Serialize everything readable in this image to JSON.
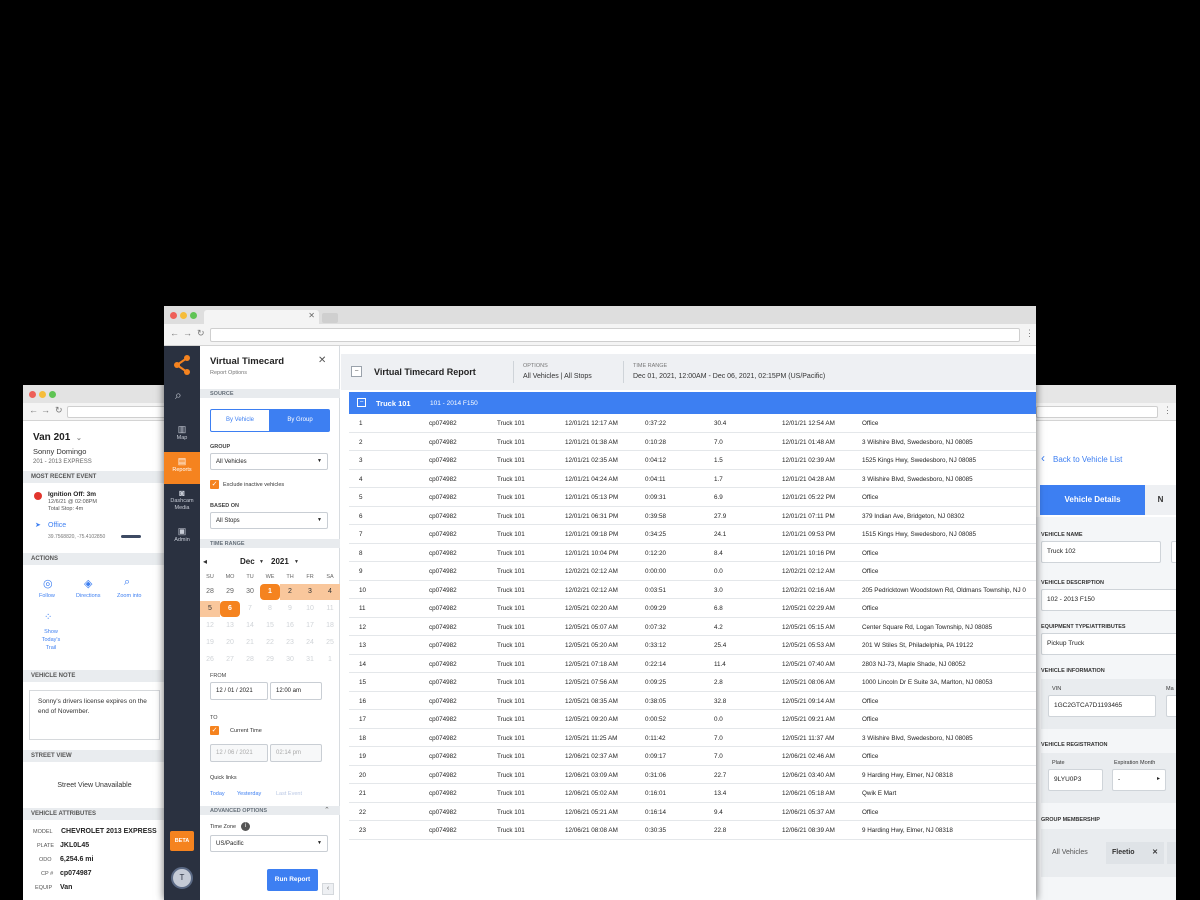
{
  "left_window": {
    "vehicle_name": "Van 201",
    "driver": "Sonny Domingo",
    "subtitle": "201 - 2013 EXPRESS",
    "most_recent_event_label": "MOST RECENT EVENT",
    "event_title": "Ignition Off: 3m",
    "event_time": "12/6/21 @ 02:08PM",
    "event_stop": "Total Stop: 4m",
    "location_name": "Office",
    "coordinates": "39.7568820, -75.4102850",
    "actions_label": "ACTIONS",
    "actions": [
      "Follow",
      "Directions",
      "Zoom into"
    ],
    "show_trail": "Show Today's Trail",
    "vehicle_note_label": "VEHICLE NOTE",
    "note_text": "Sonny's drivers license expires on the end of November.",
    "street_view_label": "STREET VIEW",
    "street_view_text": "Street View Unavailable",
    "attributes_label": "VEHICLE ATTRIBUTES",
    "attributes": [
      {
        "key": "MODEL",
        "value": "CHEVROLET 2013 EXPRESS"
      },
      {
        "key": "PLATE",
        "value": "JKL0L45"
      },
      {
        "key": "ODO",
        "value": "6,254.6 mi"
      },
      {
        "key": "CP #",
        "value": "cp074987"
      },
      {
        "key": "EQUIP",
        "value": "Van"
      }
    ]
  },
  "right_window": {
    "back_link": "Back to Vehicle List",
    "tab_active": "Vehicle Details",
    "tab_next": "N",
    "vehicle_name_label": "VEHICLE NAME",
    "vehicle_name_value": "Truck 102",
    "vehicle_desc_label": "VEHICLE DESCRIPTION",
    "vehicle_desc_value": "102 - 2013 F150",
    "equip_label": "EQUIPMENT TYPE/ATTRIBUTES",
    "equip_value": "Pickup Truck",
    "info_label": "VEHICLE INFORMATION",
    "vin_label": "VIN",
    "vin_value": "1GC2GTCA7D1193465",
    "make_label": "Ma",
    "reg_label": "VEHICLE REGISTRATION",
    "plate_label": "Plate",
    "plate_value": "9LYU0P3",
    "exp_label": "Expiration Month",
    "exp_value": "-",
    "group_label": "GROUP MEMBERSHIP",
    "groups": [
      "All Vehicles",
      "Fleetio"
    ]
  },
  "sidenav": {
    "items": [
      "Map",
      "Reports",
      "Dashcam Media",
      "Admin"
    ],
    "beta": "BETA",
    "avatar": "T"
  },
  "panel": {
    "title": "Virtual Timecard",
    "subtitle": "Report Options",
    "source_label": "SOURCE",
    "by_vehicle": "By Vehicle",
    "by_group": "By Group",
    "group_label": "GROUP",
    "group_value": "All Vehicles",
    "exclude_label": "Exclude inactive vehicles",
    "based_on_label": "BASED ON",
    "based_on_value": "All Stops",
    "time_range_label": "TIME RANGE",
    "cal_month": "Dec",
    "cal_year": "2021",
    "weekdays": [
      "SU",
      "MO",
      "TU",
      "WE",
      "TH",
      "FR",
      "SA"
    ],
    "cal_rows": [
      [
        "28",
        "29",
        "30",
        "1",
        "2",
        "3",
        "4"
      ],
      [
        "5",
        "6",
        "7",
        "8",
        "9",
        "10",
        "11"
      ],
      [
        "12",
        "13",
        "14",
        "15",
        "16",
        "17",
        "18"
      ],
      [
        "19",
        "20",
        "21",
        "22",
        "23",
        "24",
        "25"
      ],
      [
        "26",
        "27",
        "28",
        "29",
        "30",
        "31",
        "1"
      ]
    ],
    "from_label": "FROM",
    "from_date": "12 / 01 / 2021",
    "from_time": "12:00 am",
    "to_label": "TO",
    "current_time_label": "Current Time",
    "to_date": "12 / 06 / 2021",
    "to_time": "02:14 pm",
    "quick_links_label": "Quick links",
    "quick_links": [
      "Today",
      "Yesterday",
      "Last Event"
    ],
    "advanced_label": "ADVANCED OPTIONS",
    "timezone_label": "Time Zone",
    "timezone_value": "US/Pacific",
    "run_button": "Run Report"
  },
  "report": {
    "title": "Virtual Timecard Report",
    "options_label": "OPTIONS",
    "options_value": "All Vehicles | All Stops",
    "time_range_label": "TIME RANGE",
    "time_range_value": "Dec 01, 2021, 12:00AM - Dec 06, 2021, 02:15PM (US/Pacific)",
    "group_name": "Truck 101",
    "group_desc": "101 - 2014 F150",
    "rows": [
      [
        "1",
        "cp074982",
        "Truck 101",
        "12/01/21 12:17 AM",
        "0:37:22",
        "30.4",
        "12/01/21 12:54 AM",
        "Office"
      ],
      [
        "2",
        "cp074982",
        "Truck 101",
        "12/01/21 01:38 AM",
        "0:10:28",
        "7.0",
        "12/01/21 01:48 AM",
        "3 Wilshire Blvd, Swedesboro, NJ 08085"
      ],
      [
        "3",
        "cp074982",
        "Truck 101",
        "12/01/21 02:35 AM",
        "0:04:12",
        "1.5",
        "12/01/21 02:39 AM",
        "1525 Kings Hwy, Swedesboro, NJ 08085"
      ],
      [
        "4",
        "cp074982",
        "Truck 101",
        "12/01/21 04:24 AM",
        "0:04:11",
        "1.7",
        "12/01/21 04:28 AM",
        "3 Wilshire Blvd, Swedesboro, NJ 08085"
      ],
      [
        "5",
        "cp074982",
        "Truck 101",
        "12/01/21 05:13 PM",
        "0:09:31",
        "6.9",
        "12/01/21 05:22 PM",
        "Office"
      ],
      [
        "6",
        "cp074982",
        "Truck 101",
        "12/01/21 06:31 PM",
        "0:39:58",
        "27.9",
        "12/01/21 07:11 PM",
        "379 Indian Ave, Bridgeton, NJ 08302"
      ],
      [
        "7",
        "cp074982",
        "Truck 101",
        "12/01/21 09:18 PM",
        "0:34:25",
        "24.1",
        "12/01/21 09:53 PM",
        "1515 Kings Hwy, Swedesboro, NJ 08085"
      ],
      [
        "8",
        "cp074982",
        "Truck 101",
        "12/01/21 10:04 PM",
        "0:12:20",
        "8.4",
        "12/01/21 10:16 PM",
        "Office"
      ],
      [
        "9",
        "cp074982",
        "Truck 101",
        "12/02/21 02:12 AM",
        "0:00:00",
        "0.0",
        "12/02/21 02:12 AM",
        "Office"
      ],
      [
        "10",
        "cp074982",
        "Truck 101",
        "12/02/21 02:12 AM",
        "0:03:51",
        "3.0",
        "12/02/21 02:16 AM",
        "205 Pedricktown Woodstown Rd, Oldmans Township, NJ 0"
      ],
      [
        "11",
        "cp074982",
        "Truck 101",
        "12/05/21 02:20 AM",
        "0:09:29",
        "6.8",
        "12/05/21 02:29 AM",
        "Office"
      ],
      [
        "12",
        "cp074982",
        "Truck 101",
        "12/05/21 05:07 AM",
        "0:07:32",
        "4.2",
        "12/05/21 05:15 AM",
        "Center Square Rd, Logan Township, NJ 08085"
      ],
      [
        "13",
        "cp074982",
        "Truck 101",
        "12/05/21 05:20 AM",
        "0:33:12",
        "25.4",
        "12/05/21 05:53 AM",
        "201 W Stiles St, Philadelphia, PA 19122"
      ],
      [
        "14",
        "cp074982",
        "Truck 101",
        "12/05/21 07:18 AM",
        "0:22:14",
        "11.4",
        "12/05/21 07:40 AM",
        "2803 NJ-73, Maple Shade, NJ 08052"
      ],
      [
        "15",
        "cp074982",
        "Truck 101",
        "12/05/21 07:56 AM",
        "0:09:25",
        "2.8",
        "12/05/21 08:06 AM",
        "1000 Lincoln Dr E Suite 3A, Marlton, NJ 08053"
      ],
      [
        "16",
        "cp074982",
        "Truck 101",
        "12/05/21 08:35 AM",
        "0:38:05",
        "32.8",
        "12/05/21 09:14 AM",
        "Office"
      ],
      [
        "17",
        "cp074982",
        "Truck 101",
        "12/05/21 09:20 AM",
        "0:00:52",
        "0.0",
        "12/05/21 09:21 AM",
        "Office"
      ],
      [
        "18",
        "cp074982",
        "Truck 101",
        "12/05/21 11:25 AM",
        "0:11:42",
        "7.0",
        "12/05/21 11:37 AM",
        "3 Wilshire Blvd, Swedesboro, NJ 08085"
      ],
      [
        "19",
        "cp074982",
        "Truck 101",
        "12/06/21 02:37 AM",
        "0:09:17",
        "7.0",
        "12/06/21 02:46 AM",
        "Office"
      ],
      [
        "20",
        "cp074982",
        "Truck 101",
        "12/06/21 03:09 AM",
        "0:31:06",
        "22.7",
        "12/06/21 03:40 AM",
        "9 Harding Hwy, Elmer, NJ 08318"
      ],
      [
        "21",
        "cp074982",
        "Truck 101",
        "12/06/21 05:02 AM",
        "0:16:01",
        "13.4",
        "12/06/21 05:18 AM",
        "Qwik E Mart"
      ],
      [
        "22",
        "cp074982",
        "Truck 101",
        "12/06/21 05:21 AM",
        "0:16:14",
        "9.4",
        "12/06/21 05:37 AM",
        "Office"
      ],
      [
        "23",
        "cp074982",
        "Truck 101",
        "12/06/21 08:08 AM",
        "0:30:35",
        "22.8",
        "12/06/21 08:39 AM",
        "9 Harding Hwy, Elmer, NJ 08318"
      ]
    ]
  },
  "colors": {
    "accent_orange": "#f5831f",
    "accent_blue": "#3d7ff2",
    "nav_dark": "#2a3140"
  }
}
